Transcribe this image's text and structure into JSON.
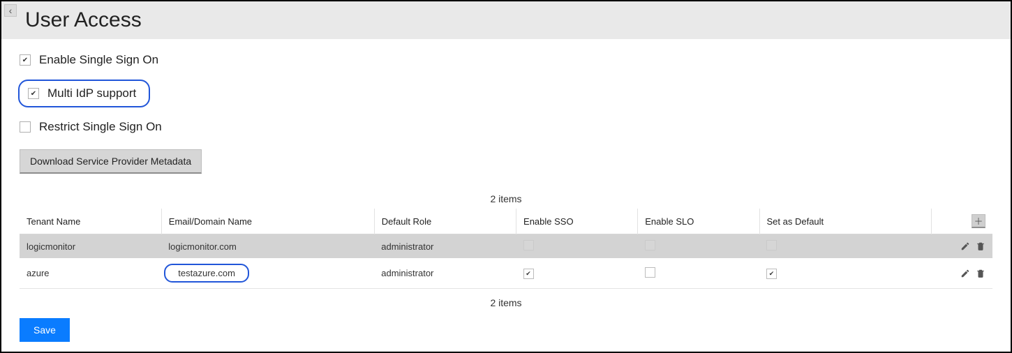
{
  "header": {
    "title": "User Access"
  },
  "options": {
    "enable_sso_label": "Enable Single Sign On",
    "enable_sso_checked": "✔",
    "multi_idp_label": "Multi IdP support",
    "multi_idp_checked": "✔",
    "restrict_sso_label": "Restrict Single Sign On",
    "restrict_sso_checked": ""
  },
  "buttons": {
    "download_metadata": "Download Service Provider Metadata",
    "save": "Save",
    "add_plus": "＋"
  },
  "table": {
    "items_count_top": "2 items",
    "items_count_bottom": "2 items",
    "headers": {
      "tenant": "Tenant Name",
      "email": "Email/Domain Name",
      "role": "Default Role",
      "enable_sso": "Enable SSO",
      "enable_slo": "Enable SLO",
      "set_default": "Set as Default"
    },
    "rows": [
      {
        "tenant": "logicmonitor",
        "email": "logicmonitor.com",
        "role": "administrator",
        "enable_sso": false,
        "enable_sso_ghost": true,
        "enable_slo": false,
        "enable_slo_ghost": true,
        "set_default": false,
        "set_default_ghost": true,
        "highlighted_email": false
      },
      {
        "tenant": "azure",
        "email": "testazure.com",
        "role": "administrator",
        "enable_sso": true,
        "enable_sso_ghost": false,
        "enable_slo": false,
        "enable_slo_ghost": false,
        "set_default": true,
        "set_default_ghost": false,
        "highlighted_email": true
      }
    ]
  }
}
